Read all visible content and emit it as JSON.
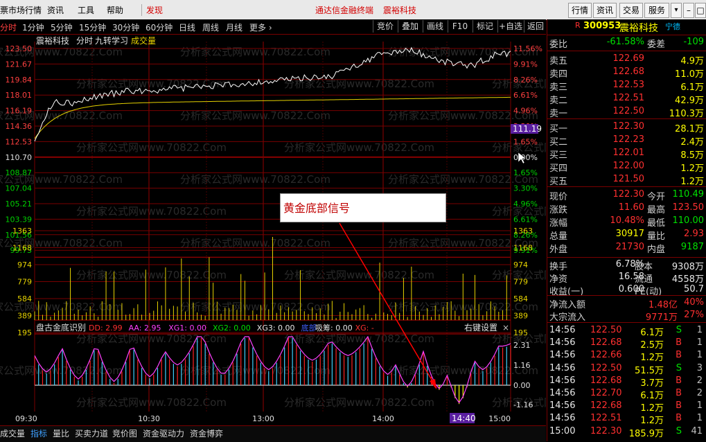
{
  "menubar": {
    "items": [
      "票市场行情",
      "资讯",
      "工具",
      "帮助",
      "发现"
    ],
    "app_title": "通达信金融终端",
    "stock_title": "震裕科技",
    "buttons": [
      "行情",
      "资讯",
      "交易",
      "服务"
    ]
  },
  "toolbar": {
    "periods": [
      "分时",
      "1分钟",
      "5分钟",
      "15分钟",
      "30分钟",
      "60分钟",
      "日线",
      "周线",
      "月线",
      "更多 ›"
    ],
    "right_buttons": [
      "竞价",
      "叠加",
      "画线",
      "F10",
      "标记",
      "+自选",
      "返回"
    ]
  },
  "chart": {
    "header_name": "震裕科技",
    "header_mode": "分时",
    "header_indicator": "九转学习",
    "header_vol": "成交量",
    "price_labels": [
      "123.50",
      "121.67",
      "119.84",
      "118.01",
      "116.19",
      "114.36",
      "112.53",
      "110.70",
      "108.87",
      "107.04",
      "105.21",
      "103.39",
      "101.56",
      "99.73"
    ],
    "pct_labels": [
      "11.56%",
      "9.91%",
      "8.26%",
      "6.61%",
      "4.96%",
      "3.30%",
      "1.65%",
      "0.00%",
      "1.65%",
      "3.30%",
      "4.96%",
      "6.61%",
      "8.26%",
      "9.91%"
    ],
    "current_price_tag": "111.19",
    "vol_labels": [
      "1363",
      "1168",
      "974",
      "779",
      "584",
      "389",
      "195"
    ],
    "indicator_name": "盘古金底识别",
    "indicator_values": [
      {
        "text": "DD: 2.99",
        "color": "#ff3030"
      },
      {
        "text": "AA: 2.95",
        "color": "#ff40ff"
      },
      {
        "text": "XG1: 0.00",
        "color": "#ff40ff"
      },
      {
        "text": "XG2: 0.00",
        "color": "#00e000"
      },
      {
        "text": "XG3: 0.00",
        "color": "#e8e8e8"
      },
      {
        "text": "底部",
        "color": "#4060ff"
      },
      {
        "text": "吸筹: 0.00",
        "color": "#e8e8e8"
      },
      {
        "text": "XG: -",
        "color": "#ff3030"
      }
    ],
    "indicator_settings": "右键设置",
    "ind_labels": [
      "2.31",
      "1.16",
      "0.00",
      "-1.16"
    ],
    "time_labels": [
      "09:30",
      "10:30",
      "13:00",
      "14:00",
      "15:00"
    ],
    "cursor_time": "14:40",
    "callout": "黄金底部信号",
    "watermark": "分析家公式网www.70822.Com"
  },
  "bottom_tabs": [
    "成交量",
    "指标",
    "量比",
    "买卖力道",
    "竞价图",
    "资金驱动力",
    "资金博弈"
  ],
  "quote": {
    "code": "300953",
    "name": "震裕科技",
    "badge": "R",
    "region": "宁德",
    "wei_bi_label": "委比",
    "wei_bi": "-61.58%",
    "wei_cha_label": "委差",
    "wei_cha": "-109",
    "sells": [
      {
        "label": "卖五",
        "price": "122.69",
        "vol": "4.9万"
      },
      {
        "label": "卖四",
        "price": "122.68",
        "vol": "11.0万"
      },
      {
        "label": "卖三",
        "price": "122.53",
        "vol": "6.1万"
      },
      {
        "label": "卖二",
        "price": "122.51",
        "vol": "42.9万"
      },
      {
        "label": "卖一",
        "price": "122.50",
        "vol": "110.3万"
      }
    ],
    "buys": [
      {
        "label": "买一",
        "price": "122.30",
        "vol": "28.1万"
      },
      {
        "label": "买二",
        "price": "122.23",
        "vol": "2.4万"
      },
      {
        "label": "买三",
        "price": "122.01",
        "vol": "8.5万"
      },
      {
        "label": "买四",
        "price": "122.00",
        "vol": "1.2万"
      },
      {
        "label": "买五",
        "price": "121.50",
        "vol": "1.2万"
      }
    ],
    "stats": [
      {
        "l1": "现价",
        "v1": "122.30",
        "c1": "up",
        "l2": "今开",
        "v2": "110.49",
        "c2": "dn"
      },
      {
        "l1": "涨跌",
        "v1": "11.60",
        "c1": "up",
        "l2": "最高",
        "v2": "123.50",
        "c2": "up"
      },
      {
        "l1": "涨幅",
        "v1": "10.48%",
        "c1": "up",
        "l2": "最低",
        "v2": "110.00",
        "c2": "dn"
      },
      {
        "l1": "总量",
        "v1": "30917",
        "c1": "yl",
        "l2": "量比",
        "v2": "2.93",
        "c2": "up"
      },
      {
        "l1": "外盘",
        "v1": "21730",
        "c1": "up",
        "l2": "内盘",
        "v2": "9187",
        "c2": "dn"
      }
    ],
    "stats2": [
      {
        "l1": "换手",
        "v1": "6.78%",
        "l2": "股本",
        "v2": "9308万"
      },
      {
        "l1": "净资",
        "v1": "16.58",
        "l2": "流通",
        "v2": "4558万"
      },
      {
        "l1": "收益(一)",
        "v1": "0.600",
        "l2": "PE(动)",
        "v2": "50.7"
      }
    ],
    "flow": [
      {
        "label": "净流入额",
        "v": "1.48亿",
        "p": "40%"
      },
      {
        "label": "大宗流入",
        "v": "9771万",
        "p": "27%"
      }
    ],
    "ticks": [
      {
        "t": "14:56",
        "p": "122.50",
        "v": "6.1万",
        "s": "S",
        "n": "1"
      },
      {
        "t": "14:56",
        "p": "122.68",
        "v": "2.5万",
        "s": "B",
        "n": "1"
      },
      {
        "t": "14:56",
        "p": "122.66",
        "v": "1.2万",
        "s": "B",
        "n": "1"
      },
      {
        "t": "14:56",
        "p": "122.50",
        "v": "51.5万",
        "s": "S",
        "n": "3"
      },
      {
        "t": "14:56",
        "p": "122.68",
        "v": "3.7万",
        "s": "B",
        "n": "2"
      },
      {
        "t": "14:56",
        "p": "122.70",
        "v": "6.1万",
        "s": "B",
        "n": "2"
      },
      {
        "t": "14:56",
        "p": "122.68",
        "v": "1.2万",
        "s": "B",
        "n": "1"
      },
      {
        "t": "14:56",
        "p": "122.51",
        "v": "1.2万",
        "s": "B",
        "n": "1"
      },
      {
        "t": "15:00",
        "p": "122.30",
        "v": "185.9万",
        "s": "S",
        "n": "41"
      }
    ]
  }
}
